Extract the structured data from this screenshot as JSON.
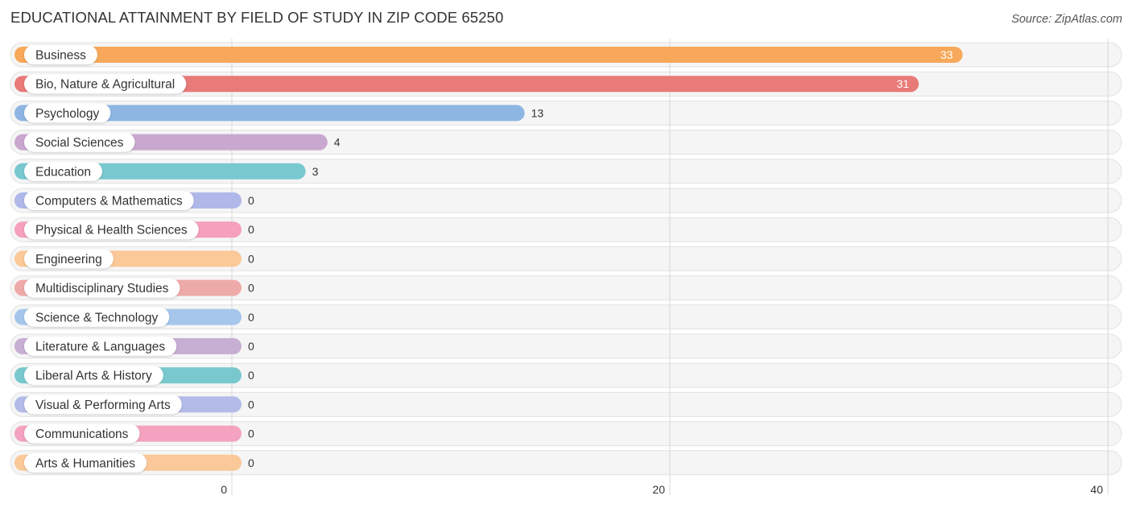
{
  "header": {
    "title": "EDUCATIONAL ATTAINMENT BY FIELD OF STUDY IN ZIP CODE 65250",
    "source": "Source: ZipAtlas.com"
  },
  "chart_data": {
    "type": "bar",
    "orientation": "horizontal",
    "title": "EDUCATIONAL ATTAINMENT BY FIELD OF STUDY IN ZIP CODE 65250",
    "xlabel": "",
    "ylabel": "",
    "xlim": [
      0,
      40
    ],
    "xticks": [
      0,
      20,
      40
    ],
    "grid": true,
    "categories": [
      "Business",
      "Bio, Nature & Agricultural",
      "Psychology",
      "Social Sciences",
      "Education",
      "Computers & Mathematics",
      "Physical & Health Sciences",
      "Engineering",
      "Multidisciplinary Studies",
      "Science & Technology",
      "Literature & Languages",
      "Liberal Arts & History",
      "Visual & Performing Arts",
      "Communications",
      "Arts & Humanities"
    ],
    "values": [
      33,
      31,
      13,
      4,
      3,
      0,
      0,
      0,
      0,
      0,
      0,
      0,
      0,
      0,
      0
    ],
    "colors": [
      "#f7a85a",
      "#e87a78",
      "#8db6e3",
      "#c9a8cf",
      "#78c8cf",
      "#b0b8ea",
      "#f5a0bd",
      "#fbc898",
      "#eeaaa9",
      "#a6c6ec",
      "#c7aed3",
      "#79c8cd",
      "#b4bbe9",
      "#f4a2bf",
      "#fbc899"
    ]
  }
}
